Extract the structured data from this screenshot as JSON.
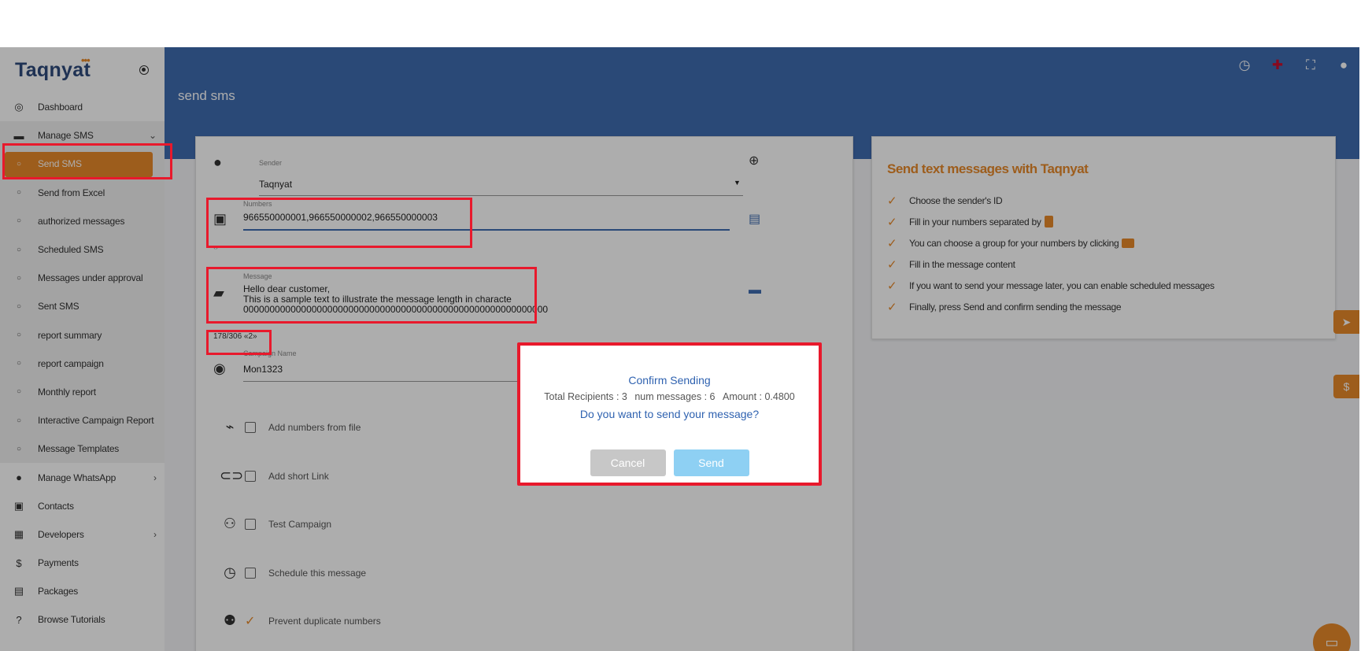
{
  "app": {
    "logo": "Taqnyat",
    "logo_dots": "•••"
  },
  "sidebar": {
    "items": [
      {
        "label": "Dashboard",
        "icon": "dashboard-icon",
        "glyph": "◎"
      },
      {
        "label": "Manage SMS",
        "icon": "sms-icon",
        "glyph": "▬",
        "arrow": "⌄"
      },
      {
        "label": "Send SMS",
        "glyph": "○"
      },
      {
        "label": "Send from Excel",
        "glyph": "○"
      },
      {
        "label": "authorized messages",
        "glyph": "○"
      },
      {
        "label": "Scheduled SMS",
        "glyph": "○"
      },
      {
        "label": "Messages under approval",
        "glyph": "○"
      },
      {
        "label": "Sent SMS",
        "glyph": "○"
      },
      {
        "label": "report summary",
        "glyph": "○"
      },
      {
        "label": "report campaign",
        "glyph": "○"
      },
      {
        "label": "Monthly report",
        "glyph": "○"
      },
      {
        "label": "Interactive Campaign Report",
        "glyph": "○"
      },
      {
        "label": "Message Templates",
        "glyph": "○"
      },
      {
        "label": "Manage WhatsApp",
        "icon": "whatsapp-icon",
        "glyph": "●",
        "arrow": "›"
      },
      {
        "label": "Contacts",
        "icon": "contacts-icon",
        "glyph": "▣"
      },
      {
        "label": "Developers",
        "icon": "developers-icon",
        "glyph": "▦",
        "arrow": "›"
      },
      {
        "label": "Payments",
        "icon": "dollar-icon",
        "glyph": "$"
      },
      {
        "label": "Packages",
        "icon": "packages-icon",
        "glyph": "▤"
      },
      {
        "label": "Browse Tutorials",
        "icon": "help-icon",
        "glyph": "?"
      }
    ]
  },
  "header": {
    "title": "send sms",
    "icons": [
      "clock-icon",
      "uk-flag-icon",
      "fullscreen-icon",
      "user-icon"
    ]
  },
  "form": {
    "sender_label": "Sender",
    "sender_value": "Taqnyat",
    "numbers_label": "Numbers",
    "numbers_value": "966550000001,966550000002,966550000003",
    "message_label": "Message",
    "message_line1": "Hello dear customer,",
    "message_line2": "This is a sample text to illustrate the message length in characte",
    "message_line3": "0000000000000000000000000000000000000000000000000000000000",
    "char_counter": "178/306 «2»",
    "campaign_label": "Campaign Name",
    "campaign_value": "Mon1323",
    "options": [
      {
        "label": "Add numbers from file",
        "checked": false
      },
      {
        "label": "Add short Link",
        "checked": false
      },
      {
        "label": "Test Campaign",
        "checked": false
      },
      {
        "label": "Schedule this message",
        "checked": false
      },
      {
        "label": "Prevent duplicate numbers",
        "checked": true
      }
    ]
  },
  "info": {
    "title": "Send text messages with Taqnyat",
    "items": [
      "Choose the sender's ID",
      "Fill in your numbers separated by",
      "You can choose a group for your numbers by clicking",
      "Fill in the message content",
      "If you want to send your message later, you can enable scheduled messages",
      "Finally, press Send and confirm sending the message"
    ]
  },
  "modal": {
    "title": "Confirm Sending",
    "recipients": "Total Recipients : 3",
    "num_messages": "num messages : 6",
    "amount": "Amount : 0.4800",
    "question": "Do you want to send your message?",
    "cancel_label": "Cancel",
    "send_label": "Send"
  },
  "colors": {
    "accent": "#e8892a",
    "header": "#3f6cb0",
    "highlight": "#e8192c",
    "send_button": "#8ed0f3"
  }
}
